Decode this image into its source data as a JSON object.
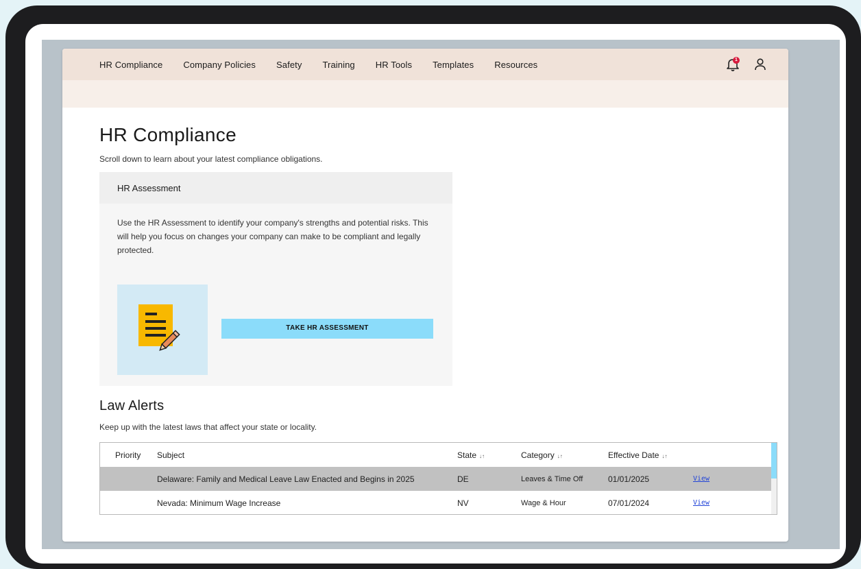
{
  "nav": {
    "items": [
      "HR Compliance",
      "Company Policies",
      "Safety",
      "Training",
      "HR Tools",
      "Templates",
      "Resources"
    ],
    "notification_count": "1"
  },
  "page": {
    "title": "HR Compliance",
    "subtitle": "Scroll down to learn about your latest compliance obligations."
  },
  "assessment": {
    "header": "HR Assessment",
    "body": "Use the HR Assessment to identify your company's strengths and potential risks. This will help you focus on changes your company can make to be compliant and legally protected.",
    "button_label": "TAKE HR ASSESSMENT",
    "illustration_icon": "document-pencil-icon"
  },
  "law_alerts": {
    "title": "Law Alerts",
    "subtitle": "Keep up with the latest laws that affect your state or locality.",
    "columns": [
      "Priority",
      "Subject",
      "State",
      "Category",
      "Effective Date"
    ],
    "sort_indicator": "↓↑",
    "rows": [
      {
        "priority": "",
        "subject": "Delaware: Family and Medical Leave Law Enacted and Begins in 2025",
        "state": "DE",
        "category": "Leaves & Time Off",
        "date": "01/01/2025",
        "action": "View"
      },
      {
        "priority": "",
        "subject": "Nevada: Minimum Wage Increase",
        "state": "NV",
        "category": "Wage & Hour",
        "date": "07/01/2024",
        "action": "View"
      }
    ]
  },
  "colors": {
    "nav_bg": "#f0e2d9",
    "subbar_bg": "#f7efe9",
    "button_bg": "#8bdcfa",
    "illustration_bg": "#d3eaf5",
    "selected_row_bg": "#c1c1c1",
    "badge": "#d8183b",
    "link": "#2043d8"
  }
}
